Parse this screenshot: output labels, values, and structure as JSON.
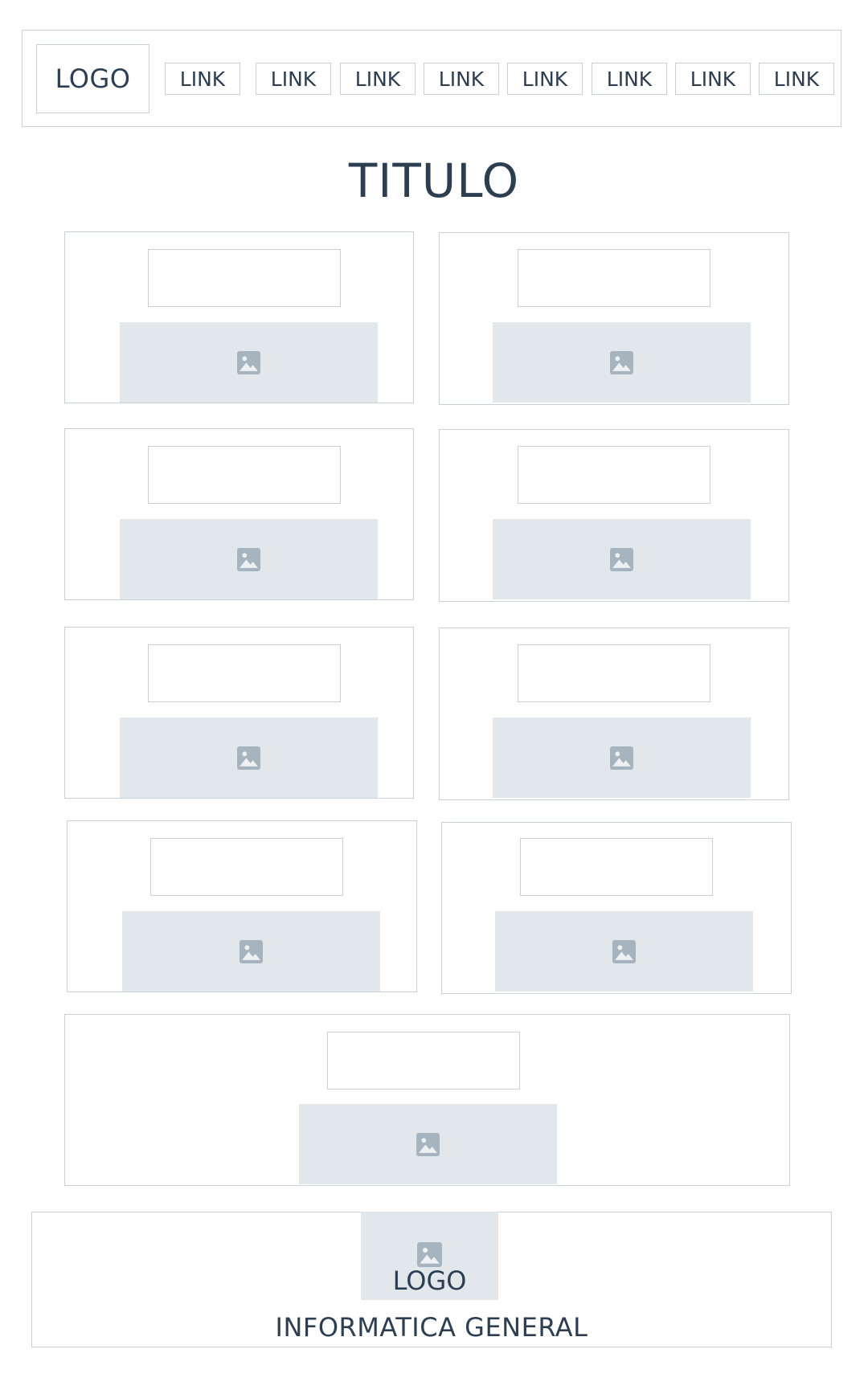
{
  "header": {
    "logo": "LOGO",
    "links": [
      "LINK",
      "LINK",
      "LINK",
      "LINK",
      "LINK",
      "LINK",
      "LINK",
      "LINK"
    ]
  },
  "page_title": "TITULO",
  "cards": [
    {
      "image_icon": "image-icon"
    },
    {
      "image_icon": "image-icon"
    },
    {
      "image_icon": "image-icon"
    },
    {
      "image_icon": "image-icon"
    },
    {
      "image_icon": "image-icon"
    },
    {
      "image_icon": "image-icon"
    },
    {
      "image_icon": "image-icon"
    },
    {
      "image_icon": "image-icon"
    },
    {
      "image_icon": "image-icon"
    }
  ],
  "footer": {
    "logo": "LOGO",
    "name": "INFORMATICA GENERAL"
  },
  "colors": {
    "border": "#c8d1da",
    "placeholder_fill": "#e2e7eb",
    "icon": "#a7b3bd",
    "text": "#2c3e50"
  }
}
